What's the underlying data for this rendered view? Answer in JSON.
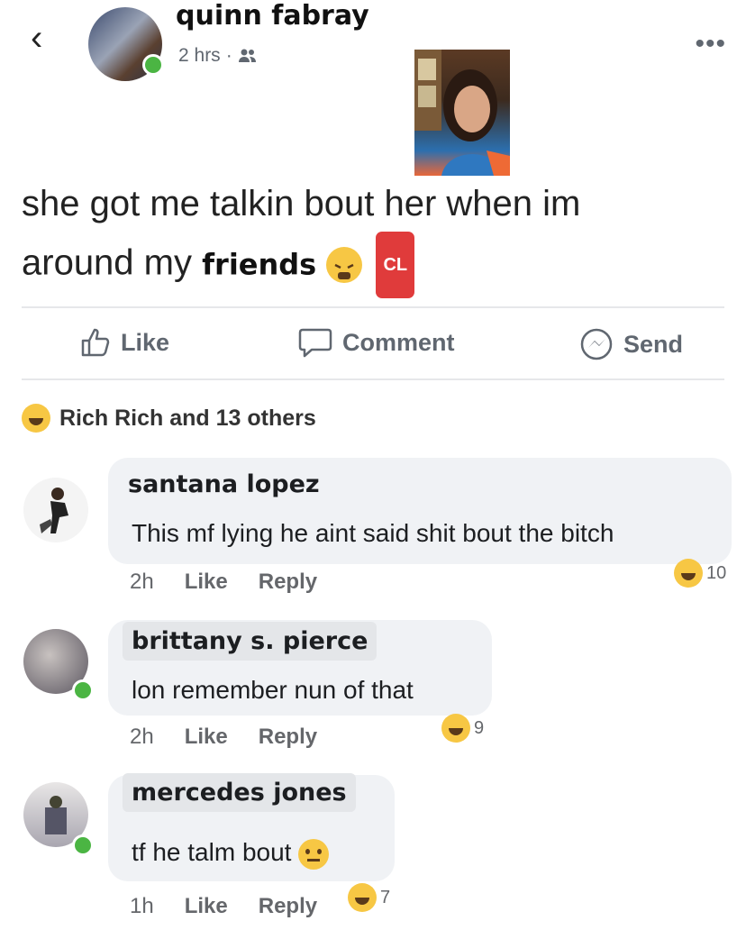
{
  "post": {
    "author": "quinn fabray",
    "time": "2 hrs",
    "separator": "·",
    "audience_icon": "friends-icon",
    "text_line1": "she got me talkin bout her when im",
    "text_line2": "around my",
    "text_bold": "friends",
    "cl_badge": "CL"
  },
  "actions": {
    "like": "Like",
    "comment": "Comment",
    "send": "Send"
  },
  "reactions": {
    "summary": "Rich Rich and 13 others"
  },
  "comments": [
    {
      "name": "santana lopez",
      "text": "This mf lying he aint said shit bout the bitch",
      "time": "2h",
      "like": "Like",
      "reply": "Reply",
      "reaction_count": "10"
    },
    {
      "name": "brittany s. pierce",
      "text": "lon remember nun of that",
      "time": "2h",
      "like": "Like",
      "reply": "Reply",
      "reaction_count": "9"
    },
    {
      "name": "mercedes jones",
      "text": "tf he talm bout",
      "time": "1h",
      "like": "Like",
      "reply": "Reply",
      "reaction_count": "7"
    }
  ],
  "colors": {
    "online": "#4bb543",
    "haha": "#f7c744",
    "cl_red": "#e03b3b",
    "muted": "#606770"
  }
}
